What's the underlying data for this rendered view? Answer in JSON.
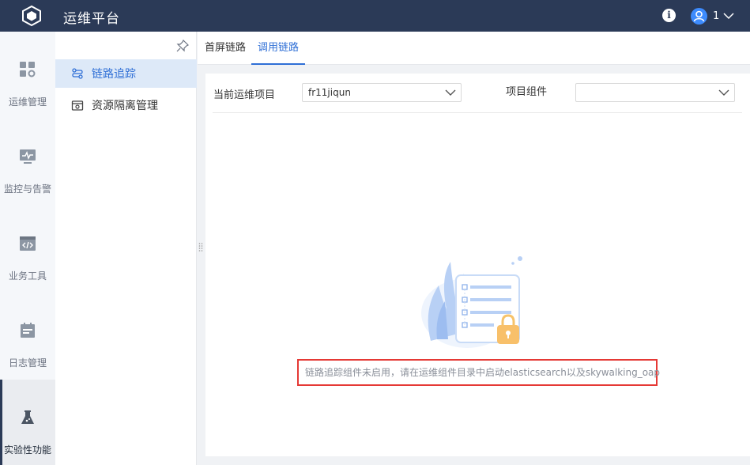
{
  "header": {
    "app_title": "运维平台",
    "logo_icon": "cube-icon",
    "info_icon": "info-icon",
    "info_glyph": "i",
    "user": {
      "avatar_icon": "user-icon",
      "name": "1",
      "chevron_icon": "chevron-down-icon"
    }
  },
  "left_nav": {
    "items": [
      {
        "label": "运维管理",
        "icon": "dashboard-icon"
      },
      {
        "label": "监控与告警",
        "icon": "monitor-icon"
      },
      {
        "label": "业务工具",
        "icon": "code-icon"
      },
      {
        "label": "日志管理",
        "icon": "calendar-icon"
      },
      {
        "label": "实验性功能",
        "icon": "flask-icon",
        "active": true
      }
    ]
  },
  "sub_nav": {
    "pin_icon": "pin-icon",
    "items": [
      {
        "label": "链路追踪",
        "icon": "link-trace-icon",
        "active": true
      },
      {
        "label": "资源隔离管理",
        "icon": "resource-icon"
      }
    ]
  },
  "tabs": [
    {
      "label": "首屏链路"
    },
    {
      "label": "调用链路",
      "active": true
    }
  ],
  "filters": {
    "project_label": "当前运维项目",
    "project_value": "fr11jiqun",
    "component_label": "项目组件",
    "component_value": ""
  },
  "empty_state": {
    "illustration": "locked-list-illustration",
    "message": "链路追踪组件未启用，请在运维组件目录中启动elasticsearch以及skywalking_oap"
  },
  "colors": {
    "header_bg": "#2b3a57",
    "accent": "#2f6fd6",
    "active_sub_bg": "#dde9f8",
    "highlight_border": "#e53935"
  }
}
